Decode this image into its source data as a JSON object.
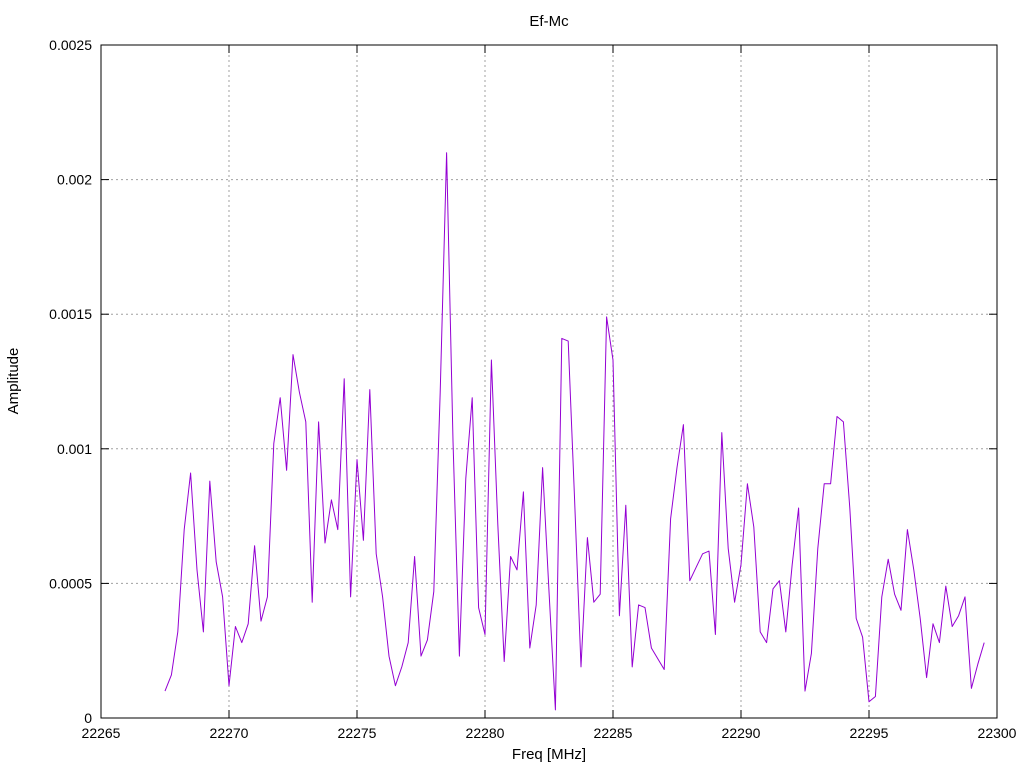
{
  "chart_data": {
    "type": "line",
    "title": "Ef-Mc",
    "xlabel": "Freq [MHz]",
    "ylabel": "Amplitude",
    "xlim": [
      22265,
      22300
    ],
    "ylim": [
      0,
      0.0025
    ],
    "xticks": [
      22265,
      22270,
      22275,
      22280,
      22285,
      22290,
      22295,
      22300
    ],
    "yticks": [
      0,
      0.0005,
      0.001,
      0.0015,
      0.002,
      0.0025
    ],
    "ytick_labels": [
      "0",
      "0.0005",
      "0.001",
      "0.0015",
      "0.002",
      "0.0025"
    ],
    "grid": true,
    "series": [
      {
        "color": "#9400d3",
        "x": [
          22267.5,
          22267.75,
          22268.0,
          22268.25,
          22268.5,
          22268.75,
          22269.0,
          22269.25,
          22269.5,
          22269.75,
          22270.0,
          22270.25,
          22270.5,
          22270.75,
          22271.0,
          22271.25,
          22271.5,
          22271.75,
          22272.0,
          22272.25,
          22272.5,
          22272.75,
          22273.0,
          22273.25,
          22273.5,
          22273.75,
          22274.0,
          22274.25,
          22274.5,
          22274.75,
          22275.0,
          22275.25,
          22275.5,
          22275.75,
          22276.0,
          22276.25,
          22276.5,
          22276.75,
          22277.0,
          22277.25,
          22277.5,
          22277.75,
          22278.0,
          22278.25,
          22278.5,
          22278.75,
          22279.0,
          22279.25,
          22279.5,
          22279.75,
          22280.0,
          22280.25,
          22280.5,
          22280.75,
          22281.0,
          22281.25,
          22281.5,
          22281.75,
          22282.0,
          22282.25,
          22282.5,
          22282.75,
          22283.0,
          22283.25,
          22283.5,
          22283.75,
          22284.0,
          22284.25,
          22284.5,
          22284.75,
          22285.0,
          22285.25,
          22285.5,
          22285.75,
          22286.0,
          22286.25,
          22286.5,
          22286.75,
          22287.0,
          22287.25,
          22287.5,
          22287.75,
          22288.0,
          22288.25,
          22288.5,
          22288.75,
          22289.0,
          22289.25,
          22289.5,
          22289.75,
          22290.0,
          22290.25,
          22290.5,
          22290.75,
          22291.0,
          22291.25,
          22291.5,
          22291.75,
          22292.0,
          22292.25,
          22292.5,
          22292.75,
          22293.0,
          22293.25,
          22293.5,
          22293.75,
          22294.0,
          22294.25,
          22294.5,
          22294.75,
          22295.0,
          22295.25,
          22295.5,
          22295.75,
          22296.0,
          22296.25,
          22296.5,
          22296.75,
          22297.0,
          22297.25,
          22297.5,
          22297.75,
          22298.0,
          22298.25,
          22298.5,
          22298.75,
          22299.0,
          22299.25,
          22299.5
        ],
        "y": [
          0.0001,
          0.00016,
          0.00032,
          0.0007,
          0.00091,
          0.00055,
          0.00032,
          0.00088,
          0.00058,
          0.00045,
          0.00012,
          0.00034,
          0.00028,
          0.00035,
          0.00064,
          0.00036,
          0.00045,
          0.00102,
          0.00119,
          0.00092,
          0.00135,
          0.00121,
          0.0011,
          0.00043,
          0.0011,
          0.00065,
          0.00081,
          0.0007,
          0.00126,
          0.00045,
          0.00096,
          0.00066,
          0.00122,
          0.00061,
          0.00045,
          0.00023,
          0.00012,
          0.00019,
          0.00028,
          0.0006,
          0.00023,
          0.00029,
          0.00047,
          0.00121,
          0.0021,
          0.00103,
          0.00023,
          0.00089,
          0.00119,
          0.00041,
          0.00031,
          0.00133,
          0.00072,
          0.00021,
          0.0006,
          0.00055,
          0.00084,
          0.00026,
          0.00042,
          0.00093,
          0.00047,
          3e-05,
          0.00141,
          0.0014,
          0.00081,
          0.00019,
          0.00067,
          0.00043,
          0.00046,
          0.00149,
          0.00133,
          0.00038,
          0.00079,
          0.00019,
          0.00042,
          0.00041,
          0.00026,
          0.00022,
          0.00018,
          0.00074,
          0.00093,
          0.00109,
          0.00051,
          0.00056,
          0.00061,
          0.00062,
          0.00031,
          0.00106,
          0.00063,
          0.00043,
          0.00057,
          0.00087,
          0.00071,
          0.00032,
          0.00028,
          0.00048,
          0.00051,
          0.00032,
          0.00057,
          0.00078,
          0.0001,
          0.00024,
          0.00063,
          0.00087,
          0.00087,
          0.00112,
          0.0011,
          0.00078,
          0.00037,
          0.0003,
          6e-05,
          8e-05,
          0.00045,
          0.00059,
          0.00046,
          0.0004,
          0.0007,
          0.00055,
          0.00037,
          0.00015,
          0.00035,
          0.00028,
          0.00049,
          0.00034,
          0.00038,
          0.00045,
          0.00011,
          0.0002,
          0.00028
        ]
      }
    ]
  }
}
